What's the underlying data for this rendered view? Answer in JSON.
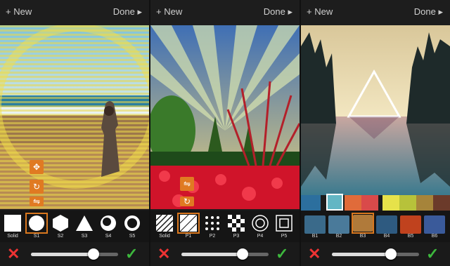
{
  "panels": [
    {
      "new_label": "+ New",
      "done_label": "Done ▸",
      "shapes": [
        "Solid",
        "S1",
        "S2",
        "S3",
        "S4",
        "S5"
      ],
      "selected_shape": "S1",
      "slider_value": 0.72
    },
    {
      "new_label": "+ New",
      "done_label": "Done ▸",
      "shapes": [
        "Solid",
        "P1",
        "P2",
        "P3",
        "P4",
        "P5"
      ],
      "selected_shape": "P1",
      "slider_value": 0.7
    },
    {
      "new_label": "+ New",
      "done_label": "Done ▸",
      "blends": [
        "B1",
        "B2",
        "B3",
        "B4",
        "B5",
        "B6"
      ],
      "selected_blend": "B3",
      "slider_value": 0.68,
      "swatch_colors": [
        "#2c6f9e",
        "#63b6c4",
        "#e06b3a",
        "#d94a4a",
        "#e6e24a",
        "#b7c23a",
        "#a6843a",
        "#6b3a2a"
      ]
    }
  ],
  "icons": {
    "cancel": "close-icon",
    "confirm": "checkmark-icon",
    "move": "move-icon",
    "rotate": "rotate-icon",
    "flip": "flip-icon"
  },
  "colors": {
    "accent": "#d9771e",
    "cancel": "#e33333",
    "confirm": "#3db83d"
  }
}
